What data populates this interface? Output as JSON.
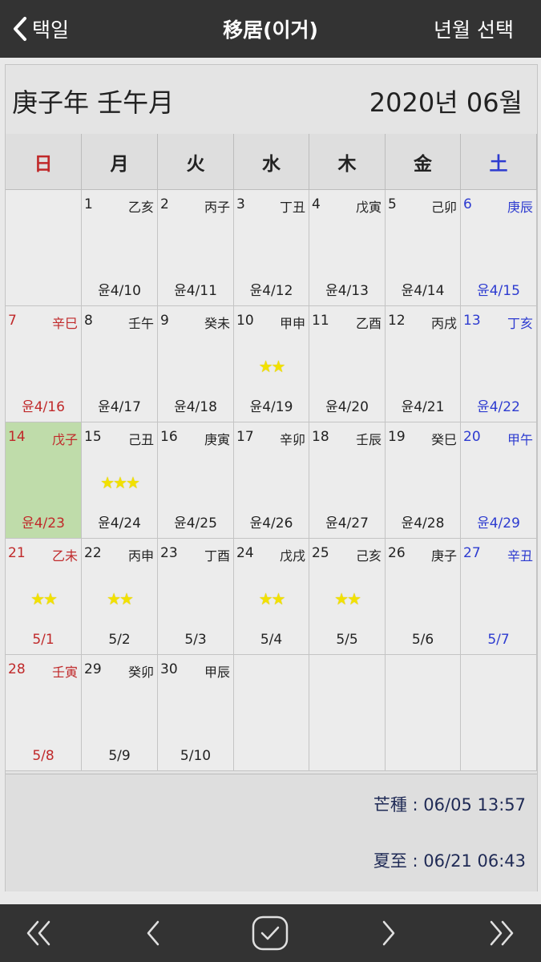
{
  "header": {
    "back_label": "택일",
    "title": "移居(이거)",
    "right_label": "년월 선택"
  },
  "month_header": {
    "ganzhi": "庚子年 壬午月",
    "year_month": "2020년 06월"
  },
  "weekdays": [
    "日",
    "月",
    "火",
    "水",
    "木",
    "金",
    "土"
  ],
  "calendar": {
    "today_day": "14",
    "weeks": [
      [
        {
          "day": "",
          "gz": "",
          "lunar": "",
          "stars": ""
        },
        {
          "day": "1",
          "gz": "乙亥",
          "lunar": "윤4/10",
          "stars": ""
        },
        {
          "day": "2",
          "gz": "丙子",
          "lunar": "윤4/11",
          "stars": ""
        },
        {
          "day": "3",
          "gz": "丁丑",
          "lunar": "윤4/12",
          "stars": ""
        },
        {
          "day": "4",
          "gz": "戊寅",
          "lunar": "윤4/13",
          "stars": ""
        },
        {
          "day": "5",
          "gz": "己卯",
          "lunar": "윤4/14",
          "stars": ""
        },
        {
          "day": "6",
          "gz": "庚辰",
          "lunar": "윤4/15",
          "stars": ""
        }
      ],
      [
        {
          "day": "7",
          "gz": "辛巳",
          "lunar": "윤4/16",
          "stars": ""
        },
        {
          "day": "8",
          "gz": "壬午",
          "lunar": "윤4/17",
          "stars": ""
        },
        {
          "day": "9",
          "gz": "癸未",
          "lunar": "윤4/18",
          "stars": ""
        },
        {
          "day": "10",
          "gz": "甲申",
          "lunar": "윤4/19",
          "stars": "★★"
        },
        {
          "day": "11",
          "gz": "乙酉",
          "lunar": "윤4/20",
          "stars": ""
        },
        {
          "day": "12",
          "gz": "丙戌",
          "lunar": "윤4/21",
          "stars": ""
        },
        {
          "day": "13",
          "gz": "丁亥",
          "lunar": "윤4/22",
          "stars": ""
        }
      ],
      [
        {
          "day": "14",
          "gz": "戊子",
          "lunar": "윤4/23",
          "stars": ""
        },
        {
          "day": "15",
          "gz": "己丑",
          "lunar": "윤4/24",
          "stars": "★★★"
        },
        {
          "day": "16",
          "gz": "庚寅",
          "lunar": "윤4/25",
          "stars": ""
        },
        {
          "day": "17",
          "gz": "辛卯",
          "lunar": "윤4/26",
          "stars": ""
        },
        {
          "day": "18",
          "gz": "壬辰",
          "lunar": "윤4/27",
          "stars": ""
        },
        {
          "day": "19",
          "gz": "癸巳",
          "lunar": "윤4/28",
          "stars": ""
        },
        {
          "day": "20",
          "gz": "甲午",
          "lunar": "윤4/29",
          "stars": ""
        }
      ],
      [
        {
          "day": "21",
          "gz": "乙未",
          "lunar": "5/1",
          "stars": "★★"
        },
        {
          "day": "22",
          "gz": "丙申",
          "lunar": "5/2",
          "stars": "★★"
        },
        {
          "day": "23",
          "gz": "丁酉",
          "lunar": "5/3",
          "stars": ""
        },
        {
          "day": "24",
          "gz": "戊戌",
          "lunar": "5/4",
          "stars": "★★"
        },
        {
          "day": "25",
          "gz": "己亥",
          "lunar": "5/5",
          "stars": "★★"
        },
        {
          "day": "26",
          "gz": "庚子",
          "lunar": "5/6",
          "stars": ""
        },
        {
          "day": "27",
          "gz": "辛丑",
          "lunar": "5/7",
          "stars": ""
        }
      ],
      [
        {
          "day": "28",
          "gz": "壬寅",
          "lunar": "5/8",
          "stars": ""
        },
        {
          "day": "29",
          "gz": "癸卯",
          "lunar": "5/9",
          "stars": ""
        },
        {
          "day": "30",
          "gz": "甲辰",
          "lunar": "5/10",
          "stars": ""
        },
        {
          "day": "",
          "gz": "",
          "lunar": "",
          "stars": ""
        },
        {
          "day": "",
          "gz": "",
          "lunar": "",
          "stars": ""
        },
        {
          "day": "",
          "gz": "",
          "lunar": "",
          "stars": ""
        },
        {
          "day": "",
          "gz": "",
          "lunar": "",
          "stars": ""
        }
      ]
    ]
  },
  "solar_terms": {
    "term1": "芒種 : 06/05 13:57",
    "term2": "夏至 : 06/21 06:43"
  },
  "colors": {
    "sunday": "#c0292a",
    "saturday": "#2d3bd0",
    "today_bg": "#bfdcaa",
    "star": "#f2e100",
    "bar_bg": "#333333"
  },
  "toolbar_icons": [
    "double-chevron-left-icon",
    "chevron-left-icon",
    "checkmark-circle-icon",
    "chevron-right-icon",
    "double-chevron-right-icon"
  ]
}
